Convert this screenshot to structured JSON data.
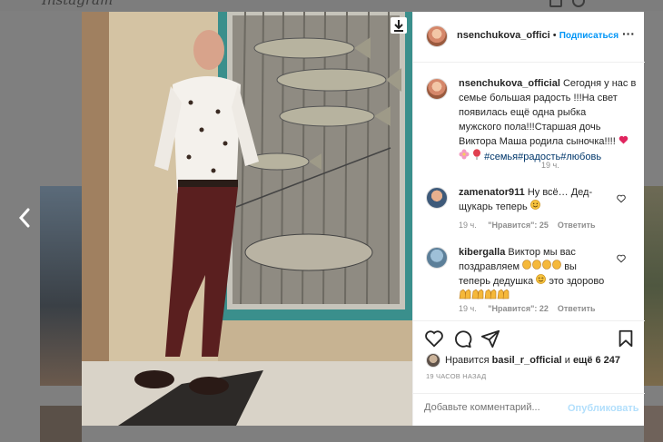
{
  "header": {
    "logo": "Instagram"
  },
  "post": {
    "author": "nsenchukova_offici",
    "follow_label": "Подписаться",
    "separator": "•",
    "more_label": "···",
    "caption_author": "nsenchukova_official",
    "caption_lines": [
      "Сегодня у нас в",
      "семье большая радость !!!На свет",
      "появилась ещё одна рыбка",
      "мужского пола!!!Старшая дочь",
      "Виктора Маша родила сыночка!!!!"
    ],
    "caption_tags": "#семья#радость#любовь",
    "caption_time": "19 ч.",
    "comments": [
      {
        "user": "zamenator911",
        "lines": [
          "Ну всё… Дед-",
          "щукарь теперь"
        ],
        "time": "19 ч.",
        "likes": "\"Нравится\": 25",
        "reply": "Ответить"
      },
      {
        "user": "kibergalla",
        "lines": [
          "Виктор мы вас",
          "поздравляем",
          "вы",
          "теперь дедушка",
          "это здорово"
        ],
        "time": "19 ч.",
        "likes": "\"Нравится\": 22",
        "reply": "Ответить"
      }
    ],
    "likes": {
      "prefix": "Нравится",
      "user": "basil_r_official",
      "mid": "и",
      "rest": "ещё 6 247"
    },
    "timestamp": "19 ЧАСОВ НАЗАД",
    "comment_placeholder": "Добавьте комментарий...",
    "publish_label": "Опубликовать"
  },
  "icons": {
    "heart": "heart-icon",
    "comment": "comment-icon",
    "share": "share-icon",
    "save": "bookmark-icon",
    "download": "download-icon",
    "prev": "chevron-left-icon"
  },
  "colors": {
    "accent": "#0095f6",
    "hashtag": "#00376b",
    "red_heart": "#e0245e"
  }
}
